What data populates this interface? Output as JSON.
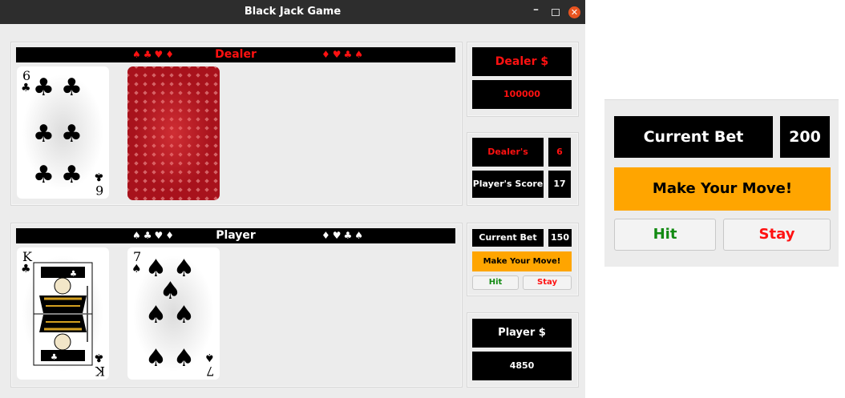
{
  "window": {
    "title": "Black Jack Game",
    "min_glyph": "–",
    "close_glyph": "✕"
  },
  "dealer": {
    "banner_label": "Dealer",
    "left_suits": "♠♣♥♦",
    "right_suits": "♦♥♣♠",
    "card1": {
      "rank": "6",
      "suit": "♣"
    },
    "card2": "face-down",
    "money_label": "Dealer $",
    "money_value": "100000"
  },
  "scores": {
    "dealer_label": "Dealer's Score",
    "dealer_value": "6",
    "player_label": "Player's Score",
    "player_value": "17"
  },
  "player": {
    "banner_label": "Player",
    "left_suits": "♠♣♥♦",
    "right_suits": "♦♥♣♠",
    "card1": {
      "rank": "K",
      "suit": "♣"
    },
    "card2": {
      "rank": "7",
      "suit": "♠"
    },
    "money_label": "Player $",
    "money_value": "4850"
  },
  "bet": {
    "label": "Current Bet",
    "value": "150",
    "prompt": "Make Your Move!",
    "hit": "Hit",
    "stay": "Stay"
  },
  "zoom": {
    "label": "Current Bet",
    "value": "200",
    "prompt": "Make Your Move!",
    "hit": "Hit",
    "stay": "Stay"
  },
  "colors": {
    "red": "#ff1111",
    "orange": "#ffa500",
    "green": "#128a12",
    "card_back": "#a8121c"
  }
}
